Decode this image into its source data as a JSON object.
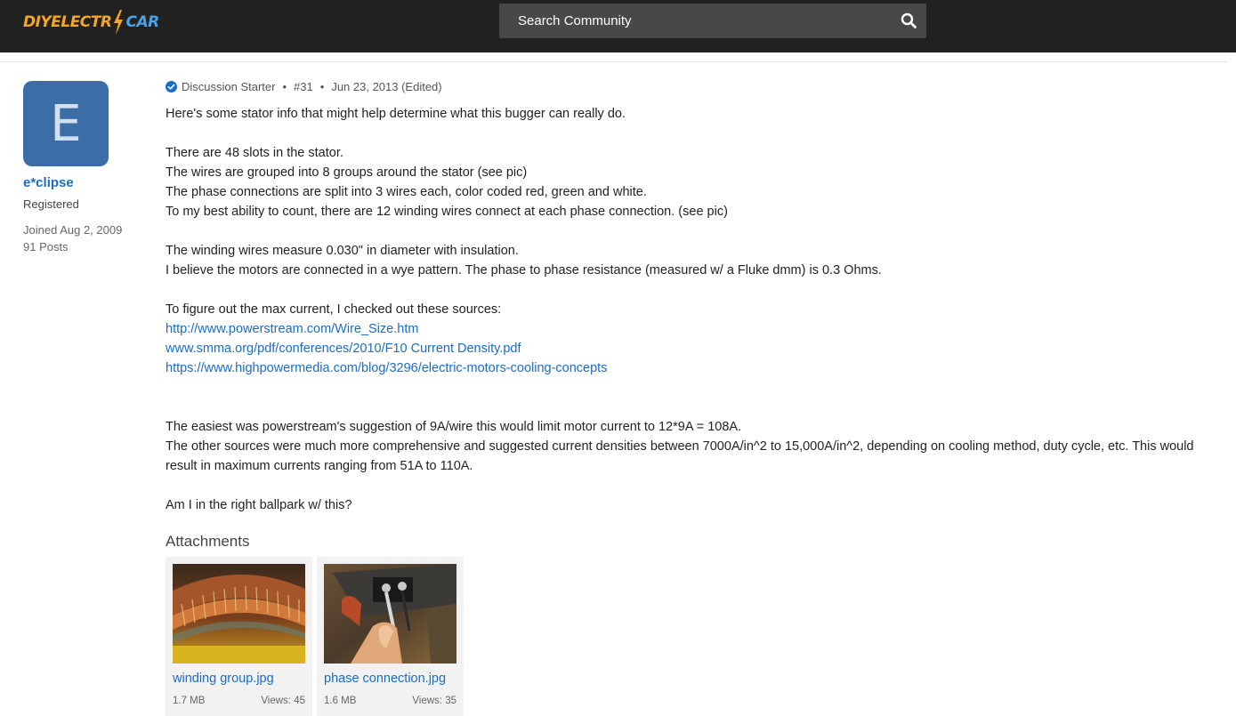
{
  "header": {
    "logo_part1": "DIYELECTR",
    "logo_part2": "CAR",
    "search_placeholder": "Search Community",
    "colors": {
      "bar": "#212121",
      "logo_orange": "#f5a623",
      "logo_blue": "#4aa3e8"
    }
  },
  "author": {
    "avatar_letter": "E",
    "username": "e*clipse",
    "role": "Registered",
    "joined": "Joined Aug 2, 2009",
    "posts": "91 Posts",
    "avatar_color": "#3b6ea6"
  },
  "post": {
    "meta": {
      "badge": "Discussion Starter",
      "number": "#31",
      "date": "Jun 23, 2013 (Edited)",
      "bullet": "•"
    },
    "lines": {
      "l1": "Here's some stator info that might help determine what this bugger can really do.",
      "l2": "There are 48 slots in the stator.",
      "l3": "The wires are grouped into 8 groups around the stator (see pic)",
      "l4": "The phase connections are split into 3 wires each, color coded red, green and white.",
      "l5": "To my best ability to count, there are 12 winding wires connect at each phase connection. (see pic)",
      "l6": "The winding wires measure 0.030\" in diameter with insulation.",
      "l7": "I believe the motors are connected in a wye pattern. The phase to phase resistance (measured w/ a Fluke dmm) is 0.3 Ohms.",
      "l8": "To figure out the max current, I checked out these sources:",
      "l9": "The easiest was powerstream's suggestion of 9A/wire this would limit motor current to 12*9A = 108A.",
      "l10": "The other sources were much more comprehensive and suggested current densities between 7000A/in^2 to 15,000A/in^2, depending on cooling method, duty cycle, etc. This would result in maximum currents ranging from 51A to 110A.",
      "l11": "Am I in the right ballpark w/ this?"
    },
    "links": [
      "http://www.powerstream.com/Wire_Size.htm",
      "www.smma.org/pdf/conferences/2010/F10 Current Density.pdf",
      "https://www.highpowermedia.com/blog/3296/electric-motors-cooling-concepts"
    ],
    "link_color": "#1a6dc6"
  },
  "attachments": {
    "title": "Attachments",
    "items": [
      {
        "name": "winding group.jpg",
        "size": "1.7 MB",
        "views": "Views: 45"
      },
      {
        "name": "phase connection.jpg",
        "size": "1.6 MB",
        "views": "Views: 35"
      }
    ]
  }
}
